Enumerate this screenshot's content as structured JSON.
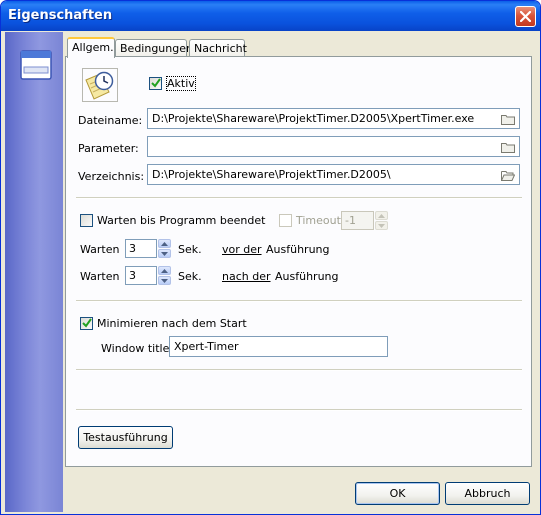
{
  "window": {
    "title": "Eigenschaften"
  },
  "tabs": [
    {
      "label": "Allgem."
    },
    {
      "label": "Bedingungen"
    },
    {
      "label": "Nachricht"
    }
  ],
  "general": {
    "active_label": "Aktiv",
    "active_checked": true,
    "filename_label": "Dateiname:",
    "filename_value": "D:\\Projekte\\Shareware\\ProjektTimer.D2005\\XpertTimer.exe",
    "parameter_label": "Parameter:",
    "parameter_value": "",
    "directory_label": "Verzeichnis:",
    "directory_value": "D:\\Projekte\\Shareware\\ProjektTimer.D2005\\"
  },
  "wait": {
    "wait_until_end_label": "Warten bis Programm beendet",
    "wait_until_end_checked": false,
    "timeout_label": "Timeout",
    "timeout_value": "-1",
    "before": {
      "label": "Warten",
      "value": "3",
      "unit": "Sek.",
      "link": "vor der",
      "suffix": "Ausführung"
    },
    "after": {
      "label": "Warten",
      "value": "3",
      "unit": "Sek.",
      "link": "nach der",
      "suffix": "Ausführung"
    }
  },
  "minimize": {
    "label": "Minimieren nach dem Start",
    "checked": true,
    "window_title_label": "Window title",
    "window_title_value": "Xpert-Timer"
  },
  "buttons": {
    "test_label": "Testausführung",
    "ok_label": "OK",
    "cancel_label": "Abbruch"
  },
  "colors": {
    "titlebar": "#0a52dd",
    "sidebar": "#7c86d8",
    "dialog_bg": "#ece9d8",
    "close_button": "#d9543a",
    "tab_highlight": "#ffc83c"
  },
  "icons": [
    "close-icon",
    "window-icon",
    "clock-document-icon",
    "folder-icon",
    "folder-open-icon",
    "checkmark-icon",
    "spin-up-icon",
    "spin-down-icon"
  ]
}
